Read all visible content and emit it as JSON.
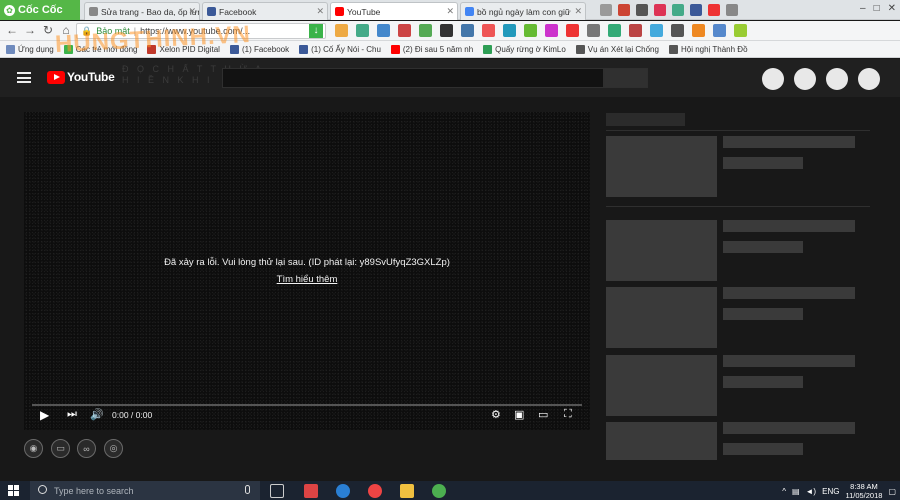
{
  "browser": {
    "brand": "Cốc Cốc",
    "tabs": [
      {
        "title": "Sửa trang - Bao da, ốp lưn",
        "color": "#888888"
      },
      {
        "title": "Facebook",
        "color": "#3b5998"
      },
      {
        "title": "YouTube",
        "color": "#ff0000",
        "active": true
      },
      {
        "title": "bồ ngủ ngày làm con giữ",
        "color": "#4285f4"
      }
    ],
    "address": "https://www.youtube.com/...",
    "address_prefix": "Bảo mật",
    "bookmarks": [
      {
        "label": "Ứng dụng",
        "color": "#6f8bbd"
      },
      {
        "label": "Các trẻ mới đồng",
        "color": "#3bb34a"
      },
      {
        "label": "Xelon PID Digital",
        "color": "#c0392b"
      },
      {
        "label": "(1) Facebook",
        "color": "#3b5998"
      },
      {
        "label": "(1) Cố Ấy Nói - Chu",
        "color": "#3b5998"
      },
      {
        "label": "(2) Đi sau 5 năm nh",
        "color": "#ff0000"
      },
      {
        "label": "Quấy rừng ờ KimLo",
        "color": "#2e9e55"
      },
      {
        "label": "Vụ án Xét lại Chống",
        "color": "#555555"
      },
      {
        "label": "Hội nghị Thành Đồ",
        "color": "#555555"
      }
    ]
  },
  "watermark": "HUNGTHINH.VN",
  "youtube": {
    "logo_text": "YouTube",
    "ghost_lines": [
      "Đ Ọ C H Ấ T T H Ừ A",
      "H I Ề N  K H I"
    ],
    "error_message": "Đã xảy ra lỗi. Vui lòng thử lại sau. (ID phát lại: y89SvUfyqZ3GXLZp)",
    "error_link": "Tìm hiểu thêm",
    "time": "0:00 / 0:00"
  },
  "taskbar": {
    "search_placeholder": "Type here to search",
    "language": "ENG",
    "time": "8:38 AM",
    "date": "11/05/2018"
  }
}
